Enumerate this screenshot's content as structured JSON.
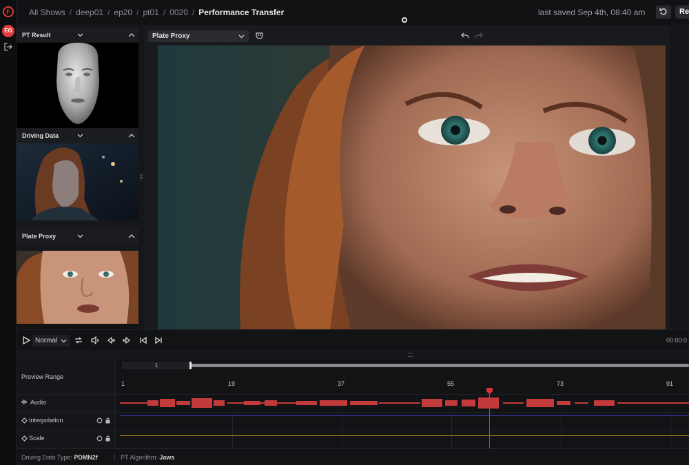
{
  "app": {
    "logo_letter": "F",
    "user_initials": "EG",
    "accent_color": "#e23a3a"
  },
  "breadcrumb": [
    "All Shows",
    "deep01",
    "ep20",
    "pt01",
    "0020"
  ],
  "page_title": "Performance Transfer",
  "last_saved": "last saved Sep 4th, 08:40 am",
  "header_button": "Re",
  "panels": [
    {
      "title": "PT Result"
    },
    {
      "title": "Driving Data"
    },
    {
      "title": "Plate Proxy"
    }
  ],
  "viewer": {
    "source_select": "Plate Proxy"
  },
  "transport": {
    "speed": "Normal",
    "timecode": "00:00:0"
  },
  "timeline": {
    "range_label": "Preview Range",
    "range_start": "1",
    "ticks": [
      "1",
      "19",
      "37",
      "55",
      "73",
      "91"
    ],
    "tracks": [
      "Audio",
      "Interpolation",
      "Scale"
    ],
    "colors": {
      "audio": "#c33a3a",
      "interpolation": "#3c3fb3",
      "scale": "#b98a2b",
      "playhead": "#d23636"
    }
  },
  "status": {
    "driving_label": "Driving Data Type:",
    "driving_value": "PDMN2f",
    "algo_label": "PT Algorithm:",
    "algo_value": "Jaws"
  }
}
